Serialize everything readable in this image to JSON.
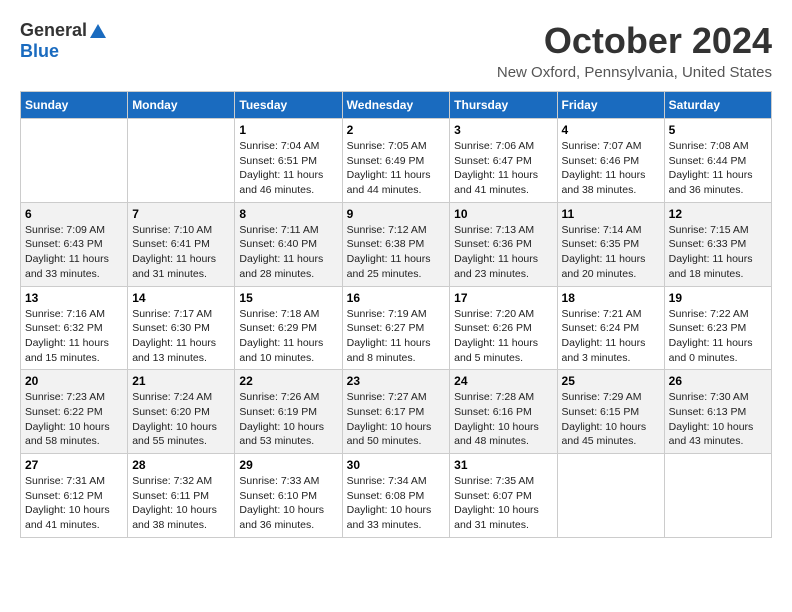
{
  "header": {
    "logo_general": "General",
    "logo_blue": "Blue",
    "month": "October 2024",
    "location": "New Oxford, Pennsylvania, United States"
  },
  "days_of_week": [
    "Sunday",
    "Monday",
    "Tuesday",
    "Wednesday",
    "Thursday",
    "Friday",
    "Saturday"
  ],
  "weeks": [
    [
      {
        "day": "",
        "info": ""
      },
      {
        "day": "",
        "info": ""
      },
      {
        "day": "1",
        "info": "Sunrise: 7:04 AM\nSunset: 6:51 PM\nDaylight: 11 hours and 46 minutes."
      },
      {
        "day": "2",
        "info": "Sunrise: 7:05 AM\nSunset: 6:49 PM\nDaylight: 11 hours and 44 minutes."
      },
      {
        "day": "3",
        "info": "Sunrise: 7:06 AM\nSunset: 6:47 PM\nDaylight: 11 hours and 41 minutes."
      },
      {
        "day": "4",
        "info": "Sunrise: 7:07 AM\nSunset: 6:46 PM\nDaylight: 11 hours and 38 minutes."
      },
      {
        "day": "5",
        "info": "Sunrise: 7:08 AM\nSunset: 6:44 PM\nDaylight: 11 hours and 36 minutes."
      }
    ],
    [
      {
        "day": "6",
        "info": "Sunrise: 7:09 AM\nSunset: 6:43 PM\nDaylight: 11 hours and 33 minutes."
      },
      {
        "day": "7",
        "info": "Sunrise: 7:10 AM\nSunset: 6:41 PM\nDaylight: 11 hours and 31 minutes."
      },
      {
        "day": "8",
        "info": "Sunrise: 7:11 AM\nSunset: 6:40 PM\nDaylight: 11 hours and 28 minutes."
      },
      {
        "day": "9",
        "info": "Sunrise: 7:12 AM\nSunset: 6:38 PM\nDaylight: 11 hours and 25 minutes."
      },
      {
        "day": "10",
        "info": "Sunrise: 7:13 AM\nSunset: 6:36 PM\nDaylight: 11 hours and 23 minutes."
      },
      {
        "day": "11",
        "info": "Sunrise: 7:14 AM\nSunset: 6:35 PM\nDaylight: 11 hours and 20 minutes."
      },
      {
        "day": "12",
        "info": "Sunrise: 7:15 AM\nSunset: 6:33 PM\nDaylight: 11 hours and 18 minutes."
      }
    ],
    [
      {
        "day": "13",
        "info": "Sunrise: 7:16 AM\nSunset: 6:32 PM\nDaylight: 11 hours and 15 minutes."
      },
      {
        "day": "14",
        "info": "Sunrise: 7:17 AM\nSunset: 6:30 PM\nDaylight: 11 hours and 13 minutes."
      },
      {
        "day": "15",
        "info": "Sunrise: 7:18 AM\nSunset: 6:29 PM\nDaylight: 11 hours and 10 minutes."
      },
      {
        "day": "16",
        "info": "Sunrise: 7:19 AM\nSunset: 6:27 PM\nDaylight: 11 hours and 8 minutes."
      },
      {
        "day": "17",
        "info": "Sunrise: 7:20 AM\nSunset: 6:26 PM\nDaylight: 11 hours and 5 minutes."
      },
      {
        "day": "18",
        "info": "Sunrise: 7:21 AM\nSunset: 6:24 PM\nDaylight: 11 hours and 3 minutes."
      },
      {
        "day": "19",
        "info": "Sunrise: 7:22 AM\nSunset: 6:23 PM\nDaylight: 11 hours and 0 minutes."
      }
    ],
    [
      {
        "day": "20",
        "info": "Sunrise: 7:23 AM\nSunset: 6:22 PM\nDaylight: 10 hours and 58 minutes."
      },
      {
        "day": "21",
        "info": "Sunrise: 7:24 AM\nSunset: 6:20 PM\nDaylight: 10 hours and 55 minutes."
      },
      {
        "day": "22",
        "info": "Sunrise: 7:26 AM\nSunset: 6:19 PM\nDaylight: 10 hours and 53 minutes."
      },
      {
        "day": "23",
        "info": "Sunrise: 7:27 AM\nSunset: 6:17 PM\nDaylight: 10 hours and 50 minutes."
      },
      {
        "day": "24",
        "info": "Sunrise: 7:28 AM\nSunset: 6:16 PM\nDaylight: 10 hours and 48 minutes."
      },
      {
        "day": "25",
        "info": "Sunrise: 7:29 AM\nSunset: 6:15 PM\nDaylight: 10 hours and 45 minutes."
      },
      {
        "day": "26",
        "info": "Sunrise: 7:30 AM\nSunset: 6:13 PM\nDaylight: 10 hours and 43 minutes."
      }
    ],
    [
      {
        "day": "27",
        "info": "Sunrise: 7:31 AM\nSunset: 6:12 PM\nDaylight: 10 hours and 41 minutes."
      },
      {
        "day": "28",
        "info": "Sunrise: 7:32 AM\nSunset: 6:11 PM\nDaylight: 10 hours and 38 minutes."
      },
      {
        "day": "29",
        "info": "Sunrise: 7:33 AM\nSunset: 6:10 PM\nDaylight: 10 hours and 36 minutes."
      },
      {
        "day": "30",
        "info": "Sunrise: 7:34 AM\nSunset: 6:08 PM\nDaylight: 10 hours and 33 minutes."
      },
      {
        "day": "31",
        "info": "Sunrise: 7:35 AM\nSunset: 6:07 PM\nDaylight: 10 hours and 31 minutes."
      },
      {
        "day": "",
        "info": ""
      },
      {
        "day": "",
        "info": ""
      }
    ]
  ]
}
